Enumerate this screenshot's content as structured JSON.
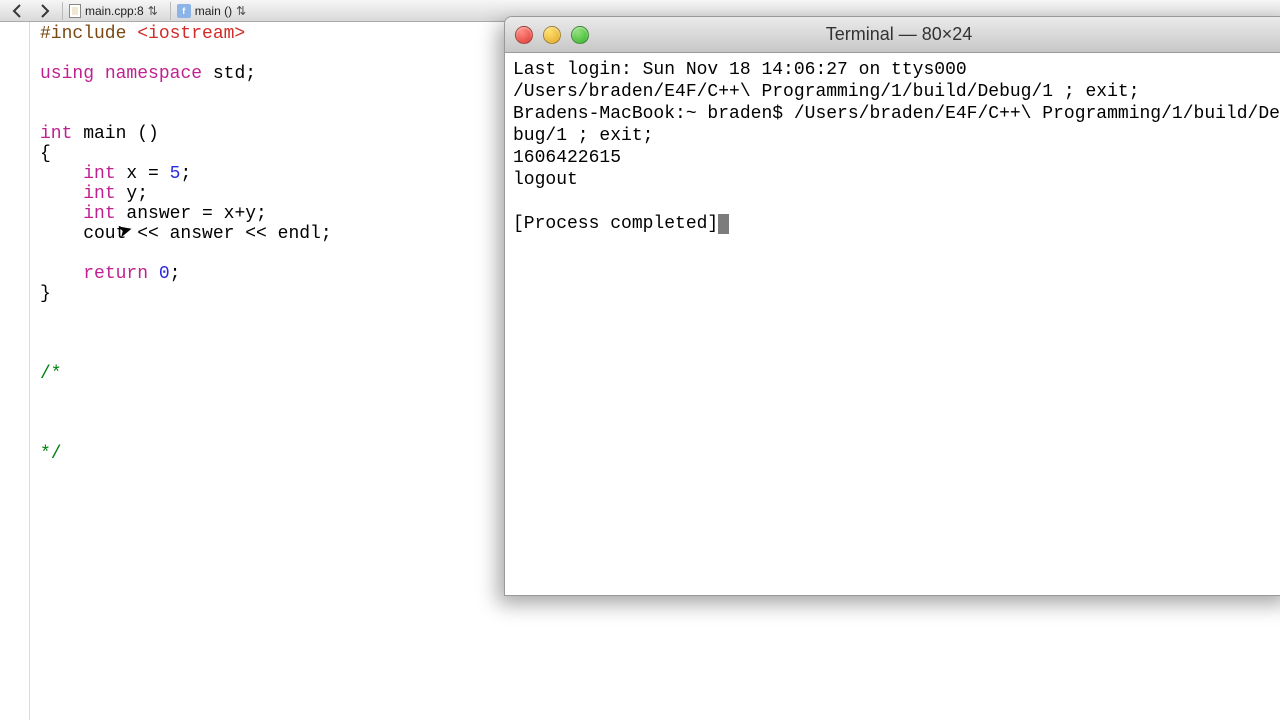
{
  "topbar": {
    "file_crumb": "main.cpp:8",
    "func_crumb": "main ()",
    "func_icon_text": "f"
  },
  "code": {
    "pp_include": "#include ",
    "include_hdr": "<iostream>",
    "kw_using": "using",
    "kw_namespace": "namespace",
    "ns_val": "std;",
    "kw_int": "int",
    "main_sig": " main ()",
    "brace_open": "{",
    "decl_x1": "    ",
    "decl_x2": " x = ",
    "num_5": "5",
    "semicolon": ";",
    "decl_y": " y;",
    "decl_ans": " answer = x+y;",
    "cout_line": "    cout << answer << endl;",
    "kw_return": "return",
    "ret_tail": " ",
    "num_0": "0",
    "brace_close": "}",
    "cmt_open": "/*",
    "cmt_close": "*/"
  },
  "terminal": {
    "title": "Terminal — 80×24",
    "lines": {
      "l1": "Last login: Sun Nov 18 14:06:27 on ttys000",
      "l2": "/Users/braden/E4F/C++\\ Programming/1/build/Debug/1 ; exit;",
      "l3": "Bradens-MacBook:~ braden$ /Users/braden/E4F/C++\\ Programming/1/build/Debug/1 ; exit;",
      "l4": "1606422615",
      "l5": "logout",
      "blank": "",
      "l6": "[Process completed]"
    }
  },
  "cursor_glyph": "↖"
}
